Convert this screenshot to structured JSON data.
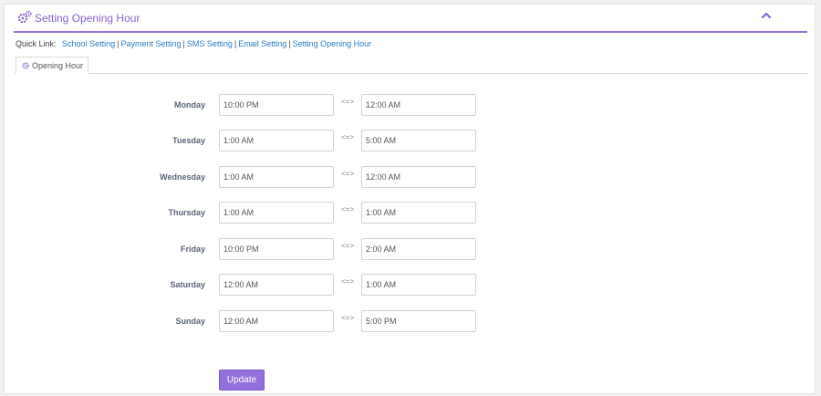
{
  "header": {
    "title": "Setting Opening Hour",
    "icon": "gears-icon",
    "collapse_icon": "chevron-up-icon"
  },
  "quick_links": {
    "label": "Quick Link:",
    "links": [
      "School Setting",
      "Payment Setting",
      "SMS Setting",
      "Email Setting",
      "Setting Opening Hour"
    ],
    "separator": "|"
  },
  "tabs": [
    {
      "label": "Opening Hour",
      "icon": "gear-icon"
    }
  ],
  "arrow_label": "<=>",
  "days": [
    {
      "day": "Monday",
      "from": "10:00 PM",
      "to": "12:00 AM"
    },
    {
      "day": "Tuesday",
      "from": "1:00 AM",
      "to": "5:00 AM"
    },
    {
      "day": "Wednesday",
      "from": "1:00 AM",
      "to": "12:00 AM"
    },
    {
      "day": "Thursday",
      "from": "1:00 AM",
      "to": "1:00 AM"
    },
    {
      "day": "Friday",
      "from": "10:00 PM",
      "to": "2:00 AM"
    },
    {
      "day": "Saturday",
      "from": "12:00 AM",
      "to": "1:00 AM"
    },
    {
      "day": "Sunday",
      "from": "12:00 AM",
      "to": "5:00 PM"
    }
  ],
  "update_label": "Update",
  "colors": {
    "accent": "#9370db",
    "link": "#2b7ac4",
    "day_label": "#5a6478"
  }
}
